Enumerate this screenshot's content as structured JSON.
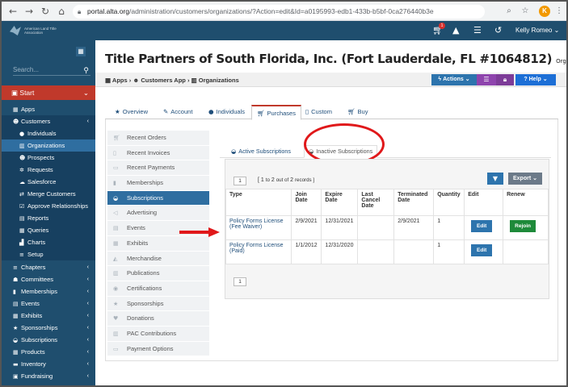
{
  "browser": {
    "url_host": "portal.alta.org",
    "url_rest": "/administration/customers/organizations/?Action=edit&Id=a0195993-edb1-433b-b5bf-0ca276440b3e",
    "profile_initial": "K"
  },
  "app": {
    "logo_text": "American Land Title Association",
    "cart_count": "1",
    "user_name": "Kelly Romeo"
  },
  "sidebar": {
    "search_placeholder": "Search...",
    "start_label": "Start",
    "items": [
      {
        "label": "Apps",
        "icon": "grid-icon"
      },
      {
        "label": "Customers",
        "icon": "users-icon"
      },
      {
        "label": "Individuals",
        "icon": "person-icon"
      },
      {
        "label": "Organizations",
        "icon": "building-icon"
      },
      {
        "label": "Prospects",
        "icon": "users-icon"
      },
      {
        "label": "Requests",
        "icon": "gear-icon"
      },
      {
        "label": "Salesforce",
        "icon": "cloud-icon"
      },
      {
        "label": "Merge Customers",
        "icon": "merge-icon"
      },
      {
        "label": "Approve Relationships",
        "icon": "check-icon"
      },
      {
        "label": "Reports",
        "icon": "chart-icon"
      },
      {
        "label": "Queries",
        "icon": "table-icon"
      },
      {
        "label": "Charts",
        "icon": "chart-icon"
      },
      {
        "label": "Setup",
        "icon": "list-icon"
      },
      {
        "label": "Chapters",
        "icon": "list-icon"
      },
      {
        "label": "Committees",
        "icon": "group-icon"
      },
      {
        "label": "Memberships",
        "icon": "bookmark-icon"
      },
      {
        "label": "Events",
        "icon": "calendar-icon"
      },
      {
        "label": "Exhibits",
        "icon": "table-icon"
      },
      {
        "label": "Sponsorships",
        "icon": "star-icon"
      },
      {
        "label": "Subscriptions",
        "icon": "drive-icon"
      },
      {
        "label": "Products",
        "icon": "grid-icon"
      },
      {
        "label": "Inventory",
        "icon": "truck-icon"
      },
      {
        "label": "Fundraising",
        "icon": "money-icon"
      }
    ]
  },
  "page": {
    "title": "Title Partners of South Florida, Inc. (Fort Lauderdale, FL #1064812)",
    "title_suffix": "Organization",
    "breadcrumb": {
      "apps": "Apps",
      "customers_app": "Customers App",
      "organizations": "Organizations"
    },
    "actions_label": "Actions",
    "help_label": "Help"
  },
  "tabs": [
    "Overview",
    "Account",
    "Individuals",
    "Purchases",
    "Custom",
    "Buy"
  ],
  "left_menu": [
    "Recent Orders",
    "Recent Invoices",
    "Recent Payments",
    "Memberships",
    "Subscriptions",
    "Advertising",
    "Events",
    "Exhibits",
    "Merchandise",
    "Publications",
    "Certifications",
    "Sponsorships",
    "Donations",
    "PAC Contributions",
    "Payment Options"
  ],
  "subtabs": {
    "active": "Active Subscriptions",
    "inactive": "Inactive Subscriptions"
  },
  "grid": {
    "page": "1",
    "records": {
      "prefix": "[ 1 ",
      "to": "to",
      "mid": " 2 ",
      "of": "out of",
      "total": " 2 ",
      "suffix": "records ]"
    },
    "export_label": "Export",
    "headers": [
      "Type",
      "Join Date",
      "Expire Date",
      "Last Cancel Date",
      "Terminated Date",
      "Quantity",
      "Edit",
      "Renew"
    ],
    "rows": [
      {
        "type": "Policy Forms License (Fee Waiver)",
        "join": "2/9/2021",
        "expire": "12/31/2021",
        "cancel": "",
        "terminated": "2/9/2021",
        "quantity": "1",
        "edit": "Edit",
        "renew": "Rejoin"
      },
      {
        "type": "Policy Forms License (Paid)",
        "join": "1/1/2012",
        "expire": "12/31/2020",
        "cancel": "",
        "terminated": "",
        "quantity": "1",
        "edit": "Edit",
        "renew": ""
      }
    ]
  },
  "colors": {
    "sidebar": "#1f4e6e",
    "start": "#c0392b",
    "accent": "#2d74ad",
    "annotation": "#e0181a"
  }
}
